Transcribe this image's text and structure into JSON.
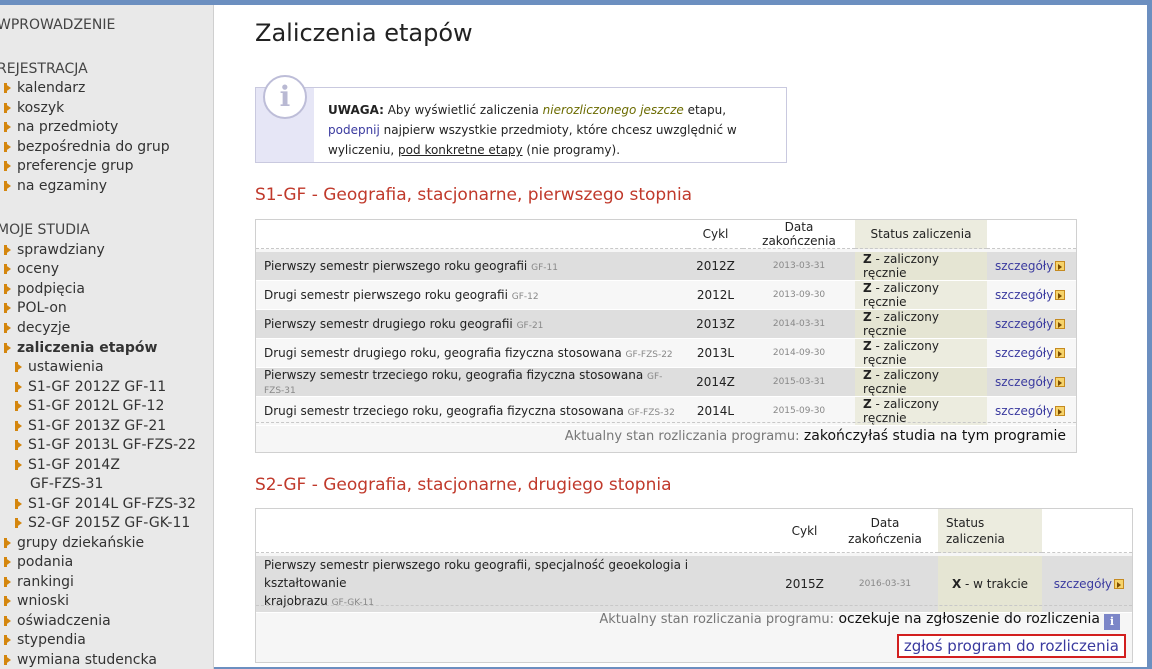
{
  "sidebar": {
    "sections": {
      "wprowadzenie": "WPROWADZENIE",
      "rejestracja": "REJESTRACJA",
      "moje_studia": "MOJE STUDIA"
    },
    "rejestracja_items": [
      "kalendarz",
      "koszyk",
      "na przedmioty",
      "bezpośrednia do grup",
      "preferencje grup",
      "na egzaminy"
    ],
    "studia_items": [
      "sprawdziany",
      "oceny",
      "podpięcia",
      "POL-on",
      "decyzje"
    ],
    "active_item": "zaliczenia etapów",
    "sub_items": [
      "ustawienia",
      "S1-GF 2012Z GF-11",
      "S1-GF 2012L GF-12",
      "S1-GF 2013Z GF-21",
      "S1-GF 2013L GF-FZS-22",
      "S1-GF 2014Z",
      "GF-FZS-31",
      "S1-GF 2014L GF-FZS-32",
      "S2-GF 2015Z GF-GK-11"
    ],
    "more_items": [
      "grupy dziekańskie",
      "podania",
      "rankingi",
      "wnioski",
      "oświadczenia",
      "stypendia",
      "wymiana studencka"
    ]
  },
  "page_title": "Zaliczenia etapów",
  "notice": {
    "label": "UWAGA:",
    "t1": " Aby wyświetlić zaliczenia ",
    "highlight": "nierozliczonego jeszcze",
    "t2": " etapu, ",
    "link1": "podepnij",
    "t3": " najpierw wszystkie przedmioty, które chcesz uwzględnić w wyliczeniu, ",
    "link2": "pod konkretne etapy",
    "t4": " (nie programy)."
  },
  "program1": {
    "title": "S1-GF - Geografia, stacjonarne, pierwszego stopnia",
    "headers": {
      "cycle": "Cykl",
      "date": "Data zakończenia",
      "status": "Status zaliczenia"
    },
    "rows": [
      {
        "name": "Pierwszy semestr pierwszego roku geografii",
        "code": "GF-11",
        "cycle": "2012Z",
        "date": "2013-03-31",
        "status_code": "Z",
        "status_text": " - zaliczony ręcznie",
        "details": "szczegóły"
      },
      {
        "name": "Drugi semestr pierwszego roku geografii",
        "code": "GF-12",
        "cycle": "2012L",
        "date": "2013-09-30",
        "status_code": "Z",
        "status_text": " - zaliczony ręcznie",
        "details": "szczegóły"
      },
      {
        "name": "Pierwszy semestr drugiego roku geografii",
        "code": "GF-21",
        "cycle": "2013Z",
        "date": "2014-03-31",
        "status_code": "Z",
        "status_text": " - zaliczony ręcznie",
        "details": "szczegóły"
      },
      {
        "name": "Drugi semestr drugiego roku, geografia fizyczna stosowana",
        "code": "GF-FZS-22",
        "cycle": "2013L",
        "date": "2014-09-30",
        "status_code": "Z",
        "status_text": " - zaliczony ręcznie",
        "details": "szczegóły"
      },
      {
        "name": "Pierwszy semestr trzeciego roku, geografia fizyczna stosowana",
        "code": "GF-FZS-31",
        "cycle": "2014Z",
        "date": "2015-03-31",
        "status_code": "Z",
        "status_text": " - zaliczony ręcznie",
        "details": "szczegóły"
      },
      {
        "name": "Drugi semestr trzeciego roku, geografia fizyczna stosowana",
        "code": "GF-FZS-32",
        "cycle": "2014L",
        "date": "2015-09-30",
        "status_code": "Z",
        "status_text": " - zaliczony ręcznie",
        "details": "szczegóły"
      }
    ],
    "progress_label": "Aktualny stan rozliczania programu:",
    "progress_value": " zakończyłaś studia na tym programie"
  },
  "program2": {
    "title": "S2-GF - Geografia, stacjonarne, drugiego stopnia",
    "headers": {
      "cycle": "Cykl",
      "date_l1": "Data",
      "date_l2": "zakończenia",
      "status_l1": "Status",
      "status_l2": "zaliczenia"
    },
    "rows": [
      {
        "name_l1": "Pierwszy semestr pierwszego roku geografii, specjalność geoekologia i kształtowanie",
        "name_l2": "krajobrazu",
        "code": "GF-GK-11",
        "cycle": "2015Z",
        "date": "2016-03-31",
        "status_code": "X",
        "status_text": " - w trakcie",
        "details": "szczegóły"
      }
    ],
    "progress_label": "Aktualny stan rozliczania programu:",
    "progress_value": " oczekuje na zgłoszenie do rozliczenia",
    "info_glyph": "i",
    "report_link": "zgłoś program do rozliczenia"
  }
}
